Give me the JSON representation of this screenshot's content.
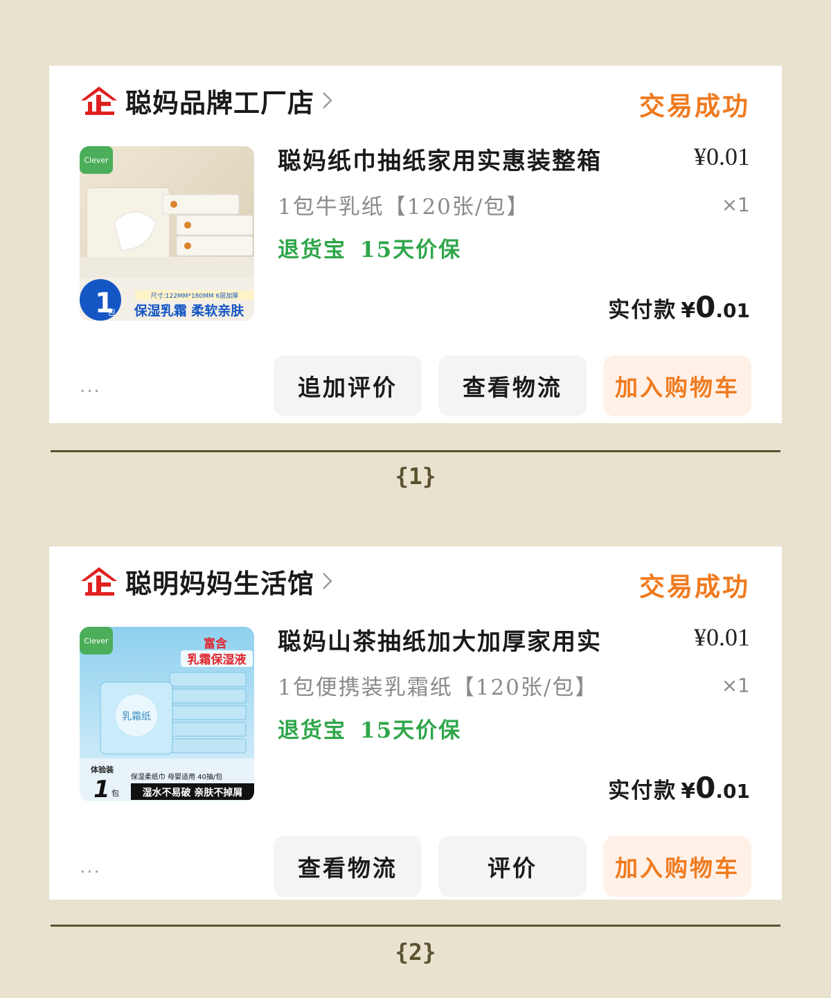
{
  "orders": [
    {
      "shop_name": "聪妈品牌工厂店",
      "status": "交易成功",
      "product_title": "聪妈纸巾抽纸家用实惠装整箱",
      "price": "¥0.01",
      "spec": "1包牛乳纸【120张/包】",
      "quantity": "×1",
      "tag_return": "退货宝",
      "tag_price_protect": "15天价保",
      "paid_label": "实付款",
      "paid_currency": "¥",
      "paid_int": "0",
      "paid_dec": ".01",
      "more": "...",
      "buttons": [
        "追加评价",
        "查看物流",
        "加入购物车"
      ],
      "image": {
        "badge_num": "1",
        "badge_unit": "包",
        "size_text": "尺寸:122MM*180MM 6层加厚",
        "banner": "保湿乳霜 柔软亲肤"
      },
      "caption": "{1}"
    },
    {
      "shop_name": "聪明妈妈生活馆",
      "status": "交易成功",
      "product_title": "聪妈山茶抽纸加大加厚家用实",
      "price": "¥0.01",
      "spec": "1包便携装乳霜纸【120张/包】",
      "quantity": "×1",
      "tag_return": "退货宝",
      "tag_price_protect": "15天价保",
      "paid_label": "实付款",
      "paid_currency": "¥",
      "paid_int": "0",
      "paid_dec": ".01",
      "more": "...",
      "buttons": [
        "查看物流",
        "评价",
        "加入购物车"
      ],
      "image": {
        "headline_top": "富含",
        "headline_main": "乳霜保湿液",
        "pack_text": "乳霜纸",
        "trial": "体验装",
        "badge_num": "1",
        "badge_unit": "包",
        "info": "保湿柔纸巾 母婴适用 40抽/包",
        "banner": "湿水不易破 亲肤不掉屑"
      },
      "caption": "{2}"
    }
  ],
  "colors": {
    "background": "#e8e2cf",
    "status_orange": "#f07a1e",
    "tag_green": "#2fa64a",
    "logo_red": "#e02020",
    "separator": "#5b5330"
  }
}
